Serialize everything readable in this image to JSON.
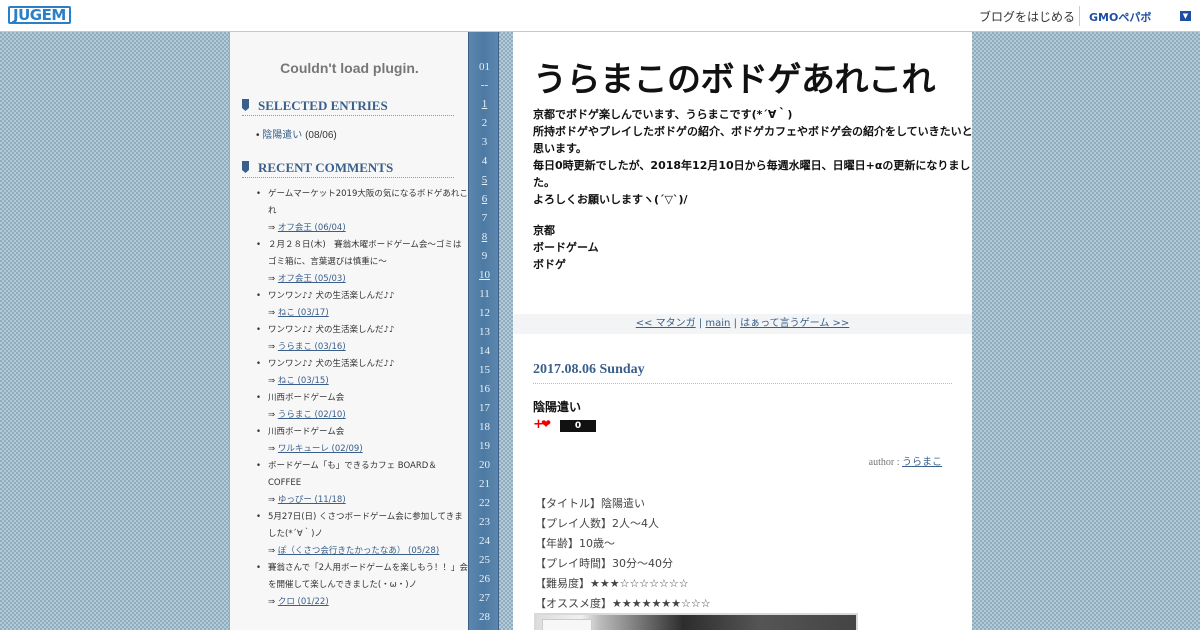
{
  "topbar": {
    "logo": "JUGEM",
    "start_blog": "ブログをはじめる",
    "gmo": "GMOペパボ",
    "menu_icon": "chevron-down-icon"
  },
  "sidebar": {
    "plugin_error": "Couldn't load plugin.",
    "selected_entries_title": "SELECTED ENTRIES",
    "selected_entries": [
      {
        "title": "陰陽遣い",
        "date": "(08/06)"
      }
    ],
    "recent_comments_title": "RECENT COMMENTS",
    "recent_comments": [
      {
        "entry": "ゲームマーケット2019大阪の気になるボドゲあれこれ",
        "by": "オフ会王 (06/04)"
      },
      {
        "entry": "２月２８日(木)　賽翁木曜ボードゲーム会～ゴミはゴミ箱に、言葉選びは慎重に～",
        "by": "オフ会王 (05/03)"
      },
      {
        "entry": "ワンワン♪♪ 犬の生活楽しんだ♪♪",
        "by": "ねこ (03/17)"
      },
      {
        "entry": "ワンワン♪♪ 犬の生活楽しんだ♪♪",
        "by": "うらまこ (03/16)"
      },
      {
        "entry": "ワンワン♪♪ 犬の生活楽しんだ♪♪",
        "by": "ねこ (03/15)"
      },
      {
        "entry": "川西ボードゲーム会",
        "by": "うらまこ (02/10)"
      },
      {
        "entry": "川西ボードゲーム会",
        "by": "ワルキューレ (02/09)"
      },
      {
        "entry": "ボードゲーム「も」できるカフェ BOARD＆COFFEE",
        "by": "ゆっぴー (11/18)"
      },
      {
        "entry": "5月27日(日) くさつボードゲーム会に参加してきました(*´∀｀)ノ",
        "by": "ぽ（くさつ会行きたかったなあ） (05/28)"
      },
      {
        "entry": "賽翁さんで「2人用ボードゲームを楽しもう！！」会を開催して楽しんできました(・ω・)ノ",
        "by": "クロ (01/22)"
      }
    ],
    "arrow": "⇒"
  },
  "calendar": {
    "month": "01",
    "separator": "--",
    "days": [
      "1",
      "2",
      "3",
      "4",
      "5",
      "6",
      "7",
      "8",
      "9",
      "10",
      "11",
      "12",
      "13",
      "14",
      "15",
      "16",
      "17",
      "18",
      "19",
      "20",
      "21",
      "22",
      "23",
      "24",
      "25",
      "26",
      "27",
      "28"
    ],
    "linked_days": [
      "1",
      "5",
      "6",
      "8",
      "10"
    ]
  },
  "main": {
    "blog_title": "うらまこのボドゲあれこれ",
    "description": [
      "京都でボドゲ楽しんでいます、うらまこです(*´∀｀)",
      "所持ボドゲやプレイしたボドゲの紹介、ボドゲカフェやボドゲ会の紹介をしていきたいと思います。",
      "毎日0時更新でしたが、2018年12月10日から毎週水曜日、日曜日+αの更新になりました。",
      "よろしくお願いしますヽ(´▽`)/"
    ],
    "tags": [
      "京都",
      "ボードゲーム",
      "ボドゲ"
    ],
    "pager": {
      "prev": "<< マタンガ",
      "sep1": " | ",
      "main": "main",
      "sep2": " | ",
      "next": "はぁって言うゲーム >>"
    },
    "date_heading": "2017.08.06 Sunday",
    "entry_title": "陰陽遣い",
    "like": {
      "plus": "+",
      "count": "0",
      "icon": "heart-icon"
    },
    "author_label": "author : ",
    "author_name": "うらまこ",
    "details": [
      "【タイトル】陰陽遣い",
      "【プレイ人数】2人～4人",
      "【年齢】10歳～",
      "【プレイ時間】30分～40分",
      "【難易度】★★★☆☆☆☆☆☆☆",
      "【オススメ度】★★★★★★★☆☆☆"
    ]
  },
  "colors": {
    "accent": "#3a5f8a",
    "calendar_bg": "#4d7aa3",
    "background": "#8eaec0",
    "heart": "#ee0000"
  }
}
